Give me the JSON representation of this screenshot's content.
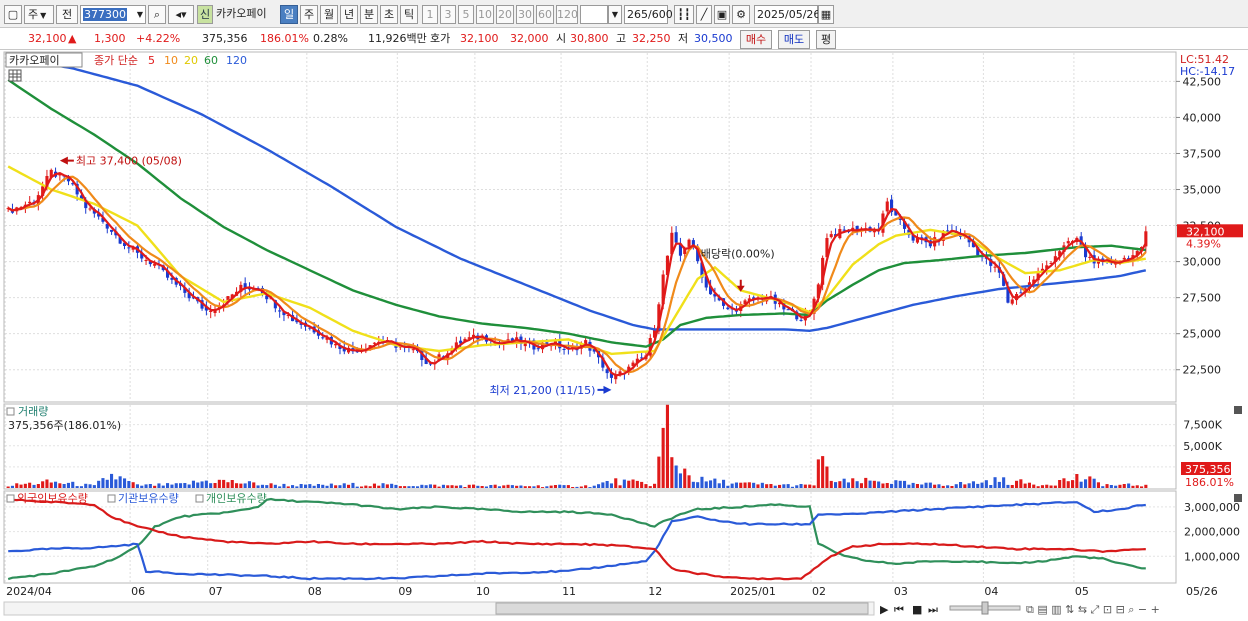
{
  "toolbar": {
    "period_select": "주",
    "prev_label": "전",
    "stock_code": "377300",
    "new_badge": "신",
    "stock_name": "카카오페이",
    "tabs": [
      "일",
      "주",
      "월",
      "년",
      "분",
      "초",
      "틱"
    ],
    "active_tab": "일",
    "periods": [
      "1",
      "3",
      "5",
      "10",
      "20",
      "30",
      "60",
      "120"
    ],
    "count": "265",
    "count_total": "/600",
    "date": "2025/05/26"
  },
  "quote": {
    "price": "32,100",
    "change": "1,300",
    "change_pct": "+4.22%",
    "volume": "375,356",
    "volume_ratio": "186.01%",
    "turnover": "0.28%",
    "amount": "11,926백만",
    "ask_label": "호가",
    "ask": "32,100",
    "bid": "32,000",
    "open_label": "시",
    "open": "30,800",
    "high_label": "고",
    "high": "32,250",
    "low_label": "저",
    "low": "30,500",
    "buy_label": "매수",
    "sell_label": "매도",
    "avg_label": "평"
  },
  "price_panel": {
    "name_tag": "카카오페이",
    "legend_label": "종가 단순",
    "ma_labels": [
      "5",
      "10",
      "20",
      "60",
      "120"
    ],
    "ma_colors": [
      "#e01a1a",
      "#f08a1a",
      "#f0e01a",
      "#1f8f3a",
      "#2a5ad8"
    ],
    "lc_label": "LC:51.42",
    "hc_label": "HC:-14.17",
    "current_price": "32,100",
    "current_pct": "4.39%",
    "high_annotation": "최고 37,400 (05/08)",
    "low_annotation": "최저 21,200 (11/15)",
    "dividend_annotation": "배당락(0.00%)"
  },
  "volume_panel": {
    "title": "거래량",
    "subtitle": "375,356주(186.01%)",
    "current_volume": "375,356",
    "current_pct": "186.01%"
  },
  "holdings_panel": {
    "legend": [
      "외국인보유수량",
      "기관보유수량",
      "개인보유수량"
    ],
    "colors": [
      "#d81a1a",
      "#2a5ad8",
      "#2f8f5a"
    ]
  },
  "bottom": {
    "x_labels": [
      "2024/04",
      "06",
      "07",
      "08",
      "09",
      "10",
      "11",
      "12",
      "2025/01",
      "02",
      "03",
      "04",
      "05",
      "05/26"
    ]
  },
  "chart_data": {
    "type": "candlestick",
    "y_ticks": [
      42500,
      40000,
      37500,
      35000,
      32500,
      30000,
      27500,
      25000,
      22500
    ],
    "ylim": [
      20400,
      44400
    ],
    "volume_ticks": [
      "7,500K",
      "5,000K",
      "2,500K"
    ],
    "volume_ylim_k": [
      0,
      9000
    ],
    "holdings_ticks": [
      "3,000,000",
      "2,000,000",
      "1,000,000"
    ],
    "holdings_ylim": [
      0,
      3400000
    ],
    "x_ticks": [
      {
        "label": "2024/04",
        "i": 0
      },
      {
        "label": "06",
        "i": 29
      },
      {
        "label": "07",
        "i": 47
      },
      {
        "label": "08",
        "i": 70
      },
      {
        "label": "09",
        "i": 91
      },
      {
        "label": "10",
        "i": 109
      },
      {
        "label": "11",
        "i": 129
      },
      {
        "label": "12",
        "i": 149
      },
      {
        "label": "2025/01",
        "i": 168
      },
      {
        "label": "02",
        "i": 187
      },
      {
        "label": "03",
        "i": 206
      },
      {
        "label": "04",
        "i": 227
      },
      {
        "label": "05",
        "i": 248
      },
      {
        "label": "05/26",
        "i": 264
      }
    ],
    "n_days": 265,
    "close_anchors": [
      [
        0,
        33500
      ],
      [
        6,
        34200
      ],
      [
        10,
        36200
      ],
      [
        14,
        35600
      ],
      [
        18,
        33800
      ],
      [
        22,
        32800
      ],
      [
        26,
        31500
      ],
      [
        30,
        30500
      ],
      [
        34,
        29800
      ],
      [
        38,
        28600
      ],
      [
        42,
        27600
      ],
      [
        46,
        26600
      ],
      [
        50,
        27200
      ],
      [
        54,
        28200
      ],
      [
        58,
        28200
      ],
      [
        62,
        27000
      ],
      [
        66,
        26000
      ],
      [
        72,
        25100
      ],
      [
        76,
        24200
      ],
      [
        80,
        23800
      ],
      [
        86,
        24500
      ],
      [
        90,
        24200
      ],
      [
        94,
        23800
      ],
      [
        98,
        22900
      ],
      [
        102,
        23800
      ],
      [
        106,
        24600
      ],
      [
        110,
        24800
      ],
      [
        114,
        24300
      ],
      [
        118,
        24500
      ],
      [
        122,
        24100
      ],
      [
        126,
        24400
      ],
      [
        130,
        23800
      ],
      [
        134,
        24400
      ],
      [
        138,
        22800
      ],
      [
        140,
        21800
      ],
      [
        144,
        22600
      ],
      [
        148,
        23500
      ],
      [
        150,
        25500
      ],
      [
        152,
        29000
      ],
      [
        154,
        31800
      ],
      [
        156,
        30400
      ],
      [
        158,
        31600
      ],
      [
        160,
        30000
      ],
      [
        162,
        28200
      ],
      [
        164,
        27600
      ],
      [
        166,
        26800
      ],
      [
        168,
        26600
      ],
      [
        172,
        27300
      ],
      [
        176,
        27600
      ],
      [
        180,
        26700
      ],
      [
        184,
        26100
      ],
      [
        186,
        26300
      ],
      [
        188,
        28600
      ],
      [
        190,
        31800
      ],
      [
        194,
        32100
      ],
      [
        198,
        32300
      ],
      [
        202,
        32200
      ],
      [
        204,
        34100
      ],
      [
        206,
        33000
      ],
      [
        210,
        31600
      ],
      [
        214,
        31200
      ],
      [
        218,
        32200
      ],
      [
        222,
        31700
      ],
      [
        226,
        30300
      ],
      [
        230,
        29200
      ],
      [
        232,
        27200
      ],
      [
        236,
        28200
      ],
      [
        240,
        29400
      ],
      [
        244,
        30800
      ],
      [
        248,
        31600
      ],
      [
        250,
        30400
      ],
      [
        254,
        29800
      ],
      [
        258,
        30100
      ],
      [
        262,
        30500
      ],
      [
        263,
        30800
      ],
      [
        264,
        32100
      ]
    ],
    "ma_anchors": {
      "ma20": [
        [
          0,
          36600
        ],
        [
          10,
          35000
        ],
        [
          20,
          34000
        ],
        [
          30,
          32500
        ],
        [
          40,
          29000
        ],
        [
          50,
          27200
        ],
        [
          60,
          27800
        ],
        [
          70,
          26800
        ],
        [
          80,
          25200
        ],
        [
          90,
          24200
        ],
        [
          100,
          23800
        ],
        [
          110,
          24200
        ],
        [
          120,
          24400
        ],
        [
          130,
          24600
        ],
        [
          140,
          23600
        ],
        [
          150,
          23800
        ],
        [
          156,
          26800
        ],
        [
          160,
          28800
        ],
        [
          164,
          29600
        ],
        [
          170,
          28000
        ],
        [
          180,
          27200
        ],
        [
          186,
          26500
        ],
        [
          190,
          27500
        ],
        [
          196,
          29800
        ],
        [
          202,
          31200
        ],
        [
          206,
          31800
        ],
        [
          214,
          32200
        ],
        [
          222,
          31800
        ],
        [
          230,
          30200
        ],
        [
          236,
          29200
        ],
        [
          244,
          29400
        ],
        [
          252,
          30100
        ],
        [
          258,
          29900
        ],
        [
          264,
          30200
        ]
      ],
      "ma60": [
        [
          0,
          42600
        ],
        [
          10,
          40600
        ],
        [
          20,
          38800
        ],
        [
          30,
          36800
        ],
        [
          40,
          34400
        ],
        [
          50,
          32400
        ],
        [
          60,
          30800
        ],
        [
          70,
          29400
        ],
        [
          80,
          28000
        ],
        [
          90,
          27000
        ],
        [
          100,
          26200
        ],
        [
          110,
          25700
        ],
        [
          120,
          25400
        ],
        [
          130,
          25000
        ],
        [
          140,
          24400
        ],
        [
          148,
          24100
        ],
        [
          152,
          24600
        ],
        [
          156,
          25600
        ],
        [
          162,
          26100
        ],
        [
          170,
          26300
        ],
        [
          180,
          26400
        ],
        [
          186,
          26300
        ],
        [
          190,
          27300
        ],
        [
          196,
          28400
        ],
        [
          202,
          29400
        ],
        [
          208,
          29900
        ],
        [
          216,
          30100
        ],
        [
          226,
          30400
        ],
        [
          236,
          30600
        ],
        [
          248,
          31000
        ],
        [
          256,
          31100
        ],
        [
          264,
          30800
        ]
      ],
      "ma120": [
        [
          0,
          44200
        ],
        [
          15,
          43400
        ],
        [
          30,
          42200
        ],
        [
          45,
          40200
        ],
        [
          60,
          37800
        ],
        [
          75,
          35200
        ],
        [
          90,
          32400
        ],
        [
          105,
          30200
        ],
        [
          120,
          28400
        ],
        [
          135,
          26600
        ],
        [
          145,
          25600
        ],
        [
          150,
          25300
        ],
        [
          160,
          25300
        ],
        [
          170,
          25300
        ],
        [
          180,
          25300
        ],
        [
          186,
          25200
        ],
        [
          190,
          25400
        ],
        [
          200,
          26200
        ],
        [
          210,
          27000
        ],
        [
          220,
          27600
        ],
        [
          230,
          28100
        ],
        [
          240,
          28400
        ],
        [
          250,
          28700
        ],
        [
          258,
          29000
        ],
        [
          264,
          29400
        ]
      ]
    },
    "volume_anchors_k": [
      [
        0,
        300
      ],
      [
        10,
        700
      ],
      [
        20,
        250
      ],
      [
        24,
        1500
      ],
      [
        30,
        300
      ],
      [
        40,
        400
      ],
      [
        47,
        900
      ],
      [
        60,
        400
      ],
      [
        70,
        300
      ],
      [
        80,
        400
      ],
      [
        100,
        300
      ],
      [
        120,
        250
      ],
      [
        136,
        250
      ],
      [
        140,
        800
      ],
      [
        146,
        600
      ],
      [
        150,
        400
      ],
      [
        151,
        3500
      ],
      [
        152,
        5500
      ],
      [
        153,
        8000
      ],
      [
        154,
        3000
      ],
      [
        156,
        2500
      ],
      [
        160,
        900
      ],
      [
        170,
        500
      ],
      [
        180,
        350
      ],
      [
        186,
        300
      ],
      [
        187,
        400
      ],
      [
        188,
        3500
      ],
      [
        189,
        2500
      ],
      [
        192,
        700
      ],
      [
        204,
        800
      ],
      [
        210,
        400
      ],
      [
        222,
        500
      ],
      [
        230,
        900
      ],
      [
        240,
        400
      ],
      [
        248,
        1200
      ],
      [
        256,
        300
      ],
      [
        264,
        375
      ]
    ],
    "foreign_anchors": [
      [
        0,
        3300000
      ],
      [
        20,
        3100000
      ],
      [
        24,
        2600000
      ],
      [
        30,
        2200000
      ],
      [
        40,
        1800000
      ],
      [
        50,
        1600000
      ],
      [
        60,
        1500000
      ],
      [
        70,
        1600000
      ],
      [
        80,
        1500000
      ],
      [
        90,
        1500000
      ],
      [
        100,
        1500000
      ],
      [
        110,
        1600000
      ],
      [
        120,
        1500000
      ],
      [
        130,
        1500000
      ],
      [
        140,
        1450000
      ],
      [
        150,
        1300000
      ],
      [
        154,
        500000
      ],
      [
        160,
        300000
      ],
      [
        170,
        100000
      ],
      [
        180,
        100000
      ],
      [
        184,
        100000
      ],
      [
        190,
        900000
      ],
      [
        196,
        1400000
      ],
      [
        204,
        1500000
      ],
      [
        214,
        1500000
      ],
      [
        224,
        1400000
      ],
      [
        234,
        1300000
      ],
      [
        244,
        1300000
      ],
      [
        254,
        1200000
      ],
      [
        264,
        1300000
      ]
    ],
    "institution_anchors": [
      [
        0,
        1200000
      ],
      [
        10,
        1300000
      ],
      [
        20,
        1350000
      ],
      [
        24,
        1400000
      ],
      [
        30,
        1500000
      ],
      [
        32,
        400000
      ],
      [
        40,
        300000
      ],
      [
        50,
        250000
      ],
      [
        60,
        200000
      ],
      [
        70,
        100000
      ],
      [
        90,
        100000
      ],
      [
        110,
        300000
      ],
      [
        130,
        400000
      ],
      [
        148,
        800000
      ],
      [
        150,
        1200000
      ],
      [
        154,
        2400000
      ],
      [
        160,
        2600000
      ],
      [
        166,
        2400000
      ],
      [
        172,
        2300000
      ],
      [
        186,
        2300000
      ],
      [
        188,
        2700000
      ],
      [
        196,
        2700000
      ],
      [
        204,
        2800000
      ],
      [
        214,
        2900000
      ],
      [
        224,
        3000000
      ],
      [
        236,
        3100000
      ],
      [
        248,
        3200000
      ],
      [
        252,
        2800000
      ],
      [
        258,
        2900000
      ],
      [
        264,
        3100000
      ]
    ],
    "individual_anchors": [
      [
        0,
        100000
      ],
      [
        10,
        300000
      ],
      [
        20,
        600000
      ],
      [
        26,
        1000000
      ],
      [
        30,
        1400000
      ],
      [
        34,
        2200000
      ],
      [
        40,
        2600000
      ],
      [
        46,
        2700000
      ],
      [
        52,
        2800000
      ],
      [
        58,
        3000000
      ],
      [
        60,
        3300000
      ],
      [
        70,
        3200000
      ],
      [
        80,
        3100000
      ],
      [
        90,
        2900000
      ],
      [
        100,
        3000000
      ],
      [
        110,
        2900000
      ],
      [
        120,
        2800000
      ],
      [
        130,
        2800000
      ],
      [
        140,
        2700000
      ],
      [
        150,
        2200000
      ],
      [
        152,
        2400000
      ],
      [
        156,
        2700000
      ],
      [
        160,
        2900000
      ],
      [
        170,
        3000000
      ],
      [
        178,
        3100000
      ],
      [
        186,
        3000000
      ],
      [
        188,
        1500000
      ],
      [
        194,
        1000000
      ],
      [
        200,
        800000
      ],
      [
        206,
        700000
      ],
      [
        214,
        800000
      ],
      [
        224,
        800000
      ],
      [
        232,
        700000
      ],
      [
        240,
        800000
      ],
      [
        248,
        1000000
      ],
      [
        254,
        900000
      ],
      [
        258,
        700000
      ],
      [
        264,
        500000
      ]
    ]
  }
}
